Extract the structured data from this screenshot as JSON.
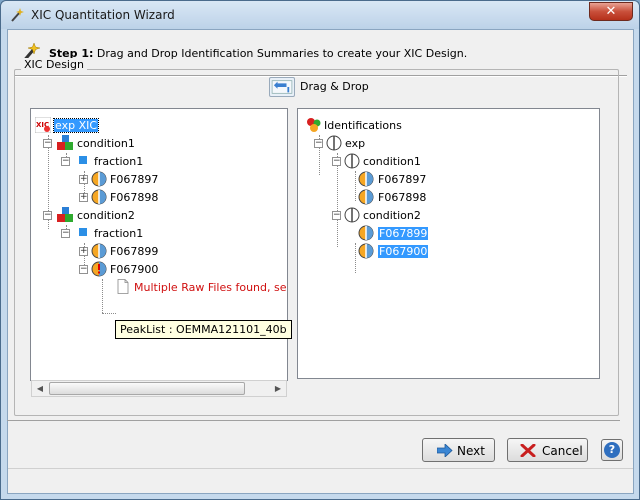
{
  "window": {
    "title": "XIC Quantitation Wizard",
    "close_label": "✕"
  },
  "step": {
    "prefix": "Step 1:",
    "text": " Drag and Drop Identification Summaries to create your XIC Design."
  },
  "group": {
    "title": "XIC Design"
  },
  "dnd": {
    "label": "Drag & Drop"
  },
  "left_tree": {
    "root": "exp XIC",
    "condition1": "condition1",
    "fraction1a": "fraction1",
    "f067897": "F067897",
    "f067898": "F067898",
    "condition2": "condition2",
    "fraction1b": "fraction1",
    "f067899": "F067899",
    "f067900": "F067900",
    "error": "Multiple Raw Files found, select"
  },
  "tooltip": {
    "text": "PeakList : OEMMA121101_40b"
  },
  "right_tree": {
    "root": "Identifications",
    "exp": "exp",
    "condition1": "condition1",
    "f067897": "F067897",
    "f067898": "F067898",
    "condition2": "condition2",
    "f067899": "F067899",
    "f067900": "F067900"
  },
  "buttons": {
    "next": "Next",
    "cancel": "Cancel",
    "help": "?"
  },
  "colors": {
    "selection": "#3399ff",
    "error": "#d01010",
    "accent": "#2f6fbf"
  }
}
